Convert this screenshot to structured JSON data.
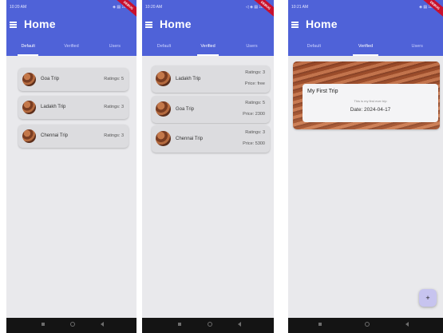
{
  "theme": {
    "accent": "#4f62d8",
    "background": "#e9e9ec",
    "card": "#dcdcdf",
    "fab": "#c7c4ef",
    "debug_ribbon": "#c8102e"
  },
  "screens": [
    {
      "status": {
        "time": "10:20 AM",
        "right": "◈ ▤ ☷.ıl ▭"
      },
      "title": "Home",
      "debug_label": "DEBUG",
      "tabs": [
        {
          "label": "Default",
          "active": true
        },
        {
          "label": "Verified",
          "active": false
        },
        {
          "label": "Users",
          "active": false
        }
      ],
      "trips": [
        {
          "name": "Goa Trip",
          "rating": "Ratings: 5"
        },
        {
          "name": "Ladakh Trip",
          "rating": "Ratings: 3"
        },
        {
          "name": "Chennai Trip",
          "rating": "Ratings: 3"
        }
      ]
    },
    {
      "status": {
        "time": "10:20 AM",
        "right": "◁ ◈ ▤ ☷.ıl ▭"
      },
      "title": "Home",
      "debug_label": "DEBUG",
      "tabs": [
        {
          "label": "Default",
          "active": false
        },
        {
          "label": "Verified",
          "active": true
        },
        {
          "label": "Users",
          "active": false
        }
      ],
      "trips": [
        {
          "name": "Ladakh Trip",
          "rating": "Ratings: 3",
          "price": "Price: free"
        },
        {
          "name": "Goa Trip",
          "rating": "Ratings: 5",
          "price": "Price: 2300"
        },
        {
          "name": "Chennai Trip",
          "rating": "Ratings: 3",
          "price": "Price: 5300"
        }
      ]
    },
    {
      "status": {
        "time": "10:21 AM",
        "right": "◈ ▤ ☷.ıl ▭"
      },
      "title": "Home",
      "debug_label": "DEBUG",
      "tabs": [
        {
          "label": "Default",
          "active": false
        },
        {
          "label": "Verified",
          "active": true
        },
        {
          "label": "Users",
          "active": false
        }
      ],
      "featured": {
        "title": "My First Trip",
        "description": "This is my first ever trip",
        "date": "Date: 2024-04-17"
      },
      "fab_label": "+"
    }
  ]
}
